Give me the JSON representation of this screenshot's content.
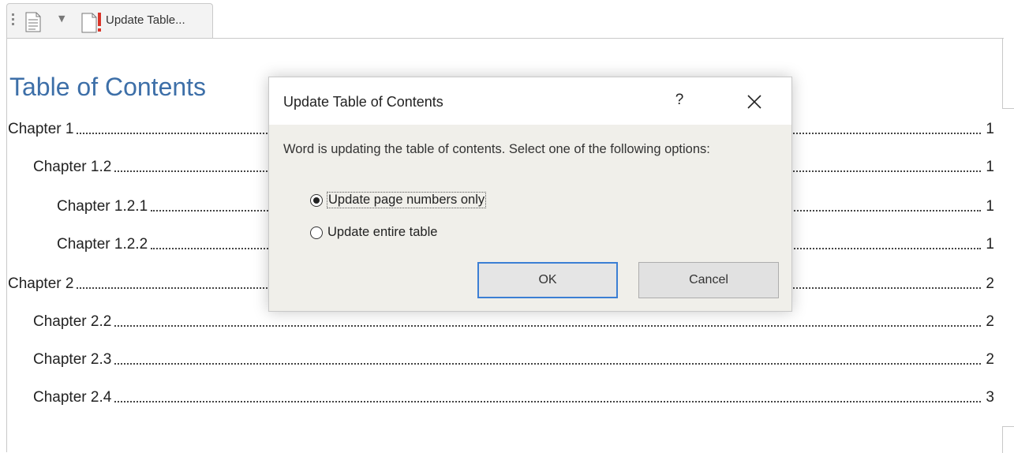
{
  "content_control": {
    "update_label": "Update Table...",
    "icons": [
      "toc-document-icon",
      "chevron-down-icon",
      "update-document-icon"
    ]
  },
  "toc": {
    "title": "Table of Contents",
    "entries": [
      {
        "text": "Chapter 1",
        "page": "1",
        "level": 1
      },
      {
        "text": "Chapter 1.2",
        "page": "1",
        "level": 2
      },
      {
        "text": "Chapter 1.2.1",
        "page": "1",
        "level": 3
      },
      {
        "text": "Chapter 1.2.2",
        "page": "1",
        "level": 3
      },
      {
        "text": "Chapter 2",
        "page": "2",
        "level": 1
      },
      {
        "text": "Chapter 2.2",
        "page": "2",
        "level": 2
      },
      {
        "text": "Chapter 2.3",
        "page": "2",
        "level": 2
      },
      {
        "text": "Chapter 2.4",
        "page": "3",
        "level": 2
      }
    ]
  },
  "dialog": {
    "title": "Update Table of Contents",
    "help_label": "?",
    "message": "Word is updating the table of contents.  Select one of the following options:",
    "options": [
      {
        "label": "Update page numbers only",
        "selected": true
      },
      {
        "label": "Update entire table",
        "selected": false
      }
    ],
    "ok_label": "OK",
    "cancel_label": "Cancel"
  },
  "colors": {
    "toc_title": "#3d6fa8",
    "dialog_bg": "#f0efea",
    "ok_border": "#3c7fd4"
  }
}
